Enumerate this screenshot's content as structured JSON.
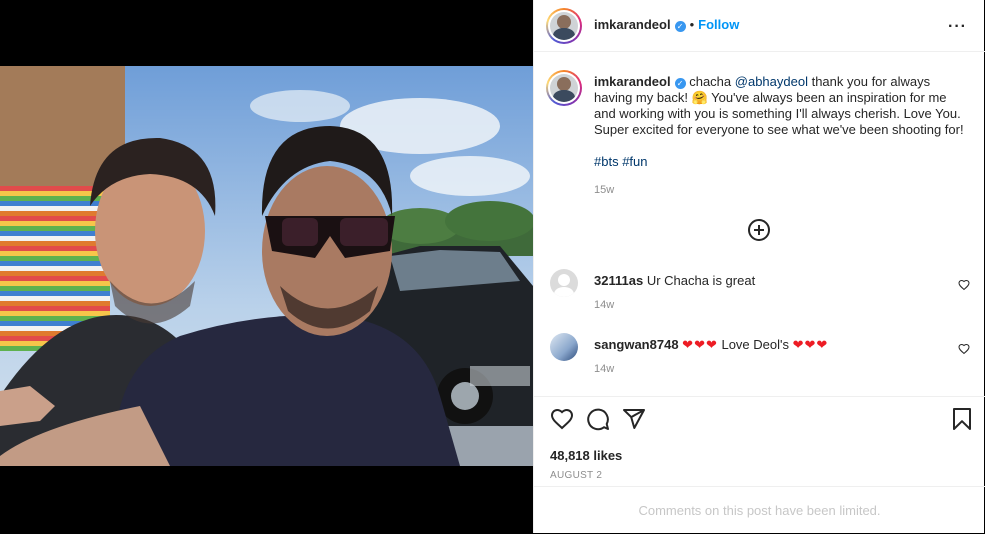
{
  "post": {
    "author": "imkarandeol",
    "follow_label": "Follow",
    "dot": "•",
    "more_label": "···"
  },
  "caption": {
    "author": "imkarandeol",
    "pre": "chacha ",
    "mention": "@abhaydeol",
    "text1": " thank you for always having my back! ",
    "emoji": "🤗",
    "text2": " You've always been an inspiration for me and working with you is something I'll always cherish. Love You.",
    "line2": "Super excited for everyone to see what we've been shooting for!",
    "hashtag1": "#bts",
    "hashtag2": "#fun",
    "time": "15w"
  },
  "comments": [
    {
      "user": "32111as",
      "text": "Ur Chacha is great",
      "time": "14w"
    },
    {
      "user": "sangwan8748",
      "hearts_before": "❤❤❤",
      "text": " Love Deol's ",
      "hearts_after": "❤❤❤",
      "time": "14w"
    }
  ],
  "stats": {
    "likes": "48,818 likes",
    "date": "AUGUST 2"
  },
  "footer": {
    "limited": "Comments on this post have been limited."
  },
  "icons": {
    "verified": "verified-badge-icon",
    "like": "heart-icon",
    "comment": "comment-icon",
    "share": "paper-plane-icon",
    "save": "bookmark-icon",
    "add": "plus-circle-icon"
  },
  "colors": {
    "accent": "#0095f6",
    "link": "#00376b",
    "muted": "#8e8e8e",
    "heart": "#ed1c24"
  }
}
